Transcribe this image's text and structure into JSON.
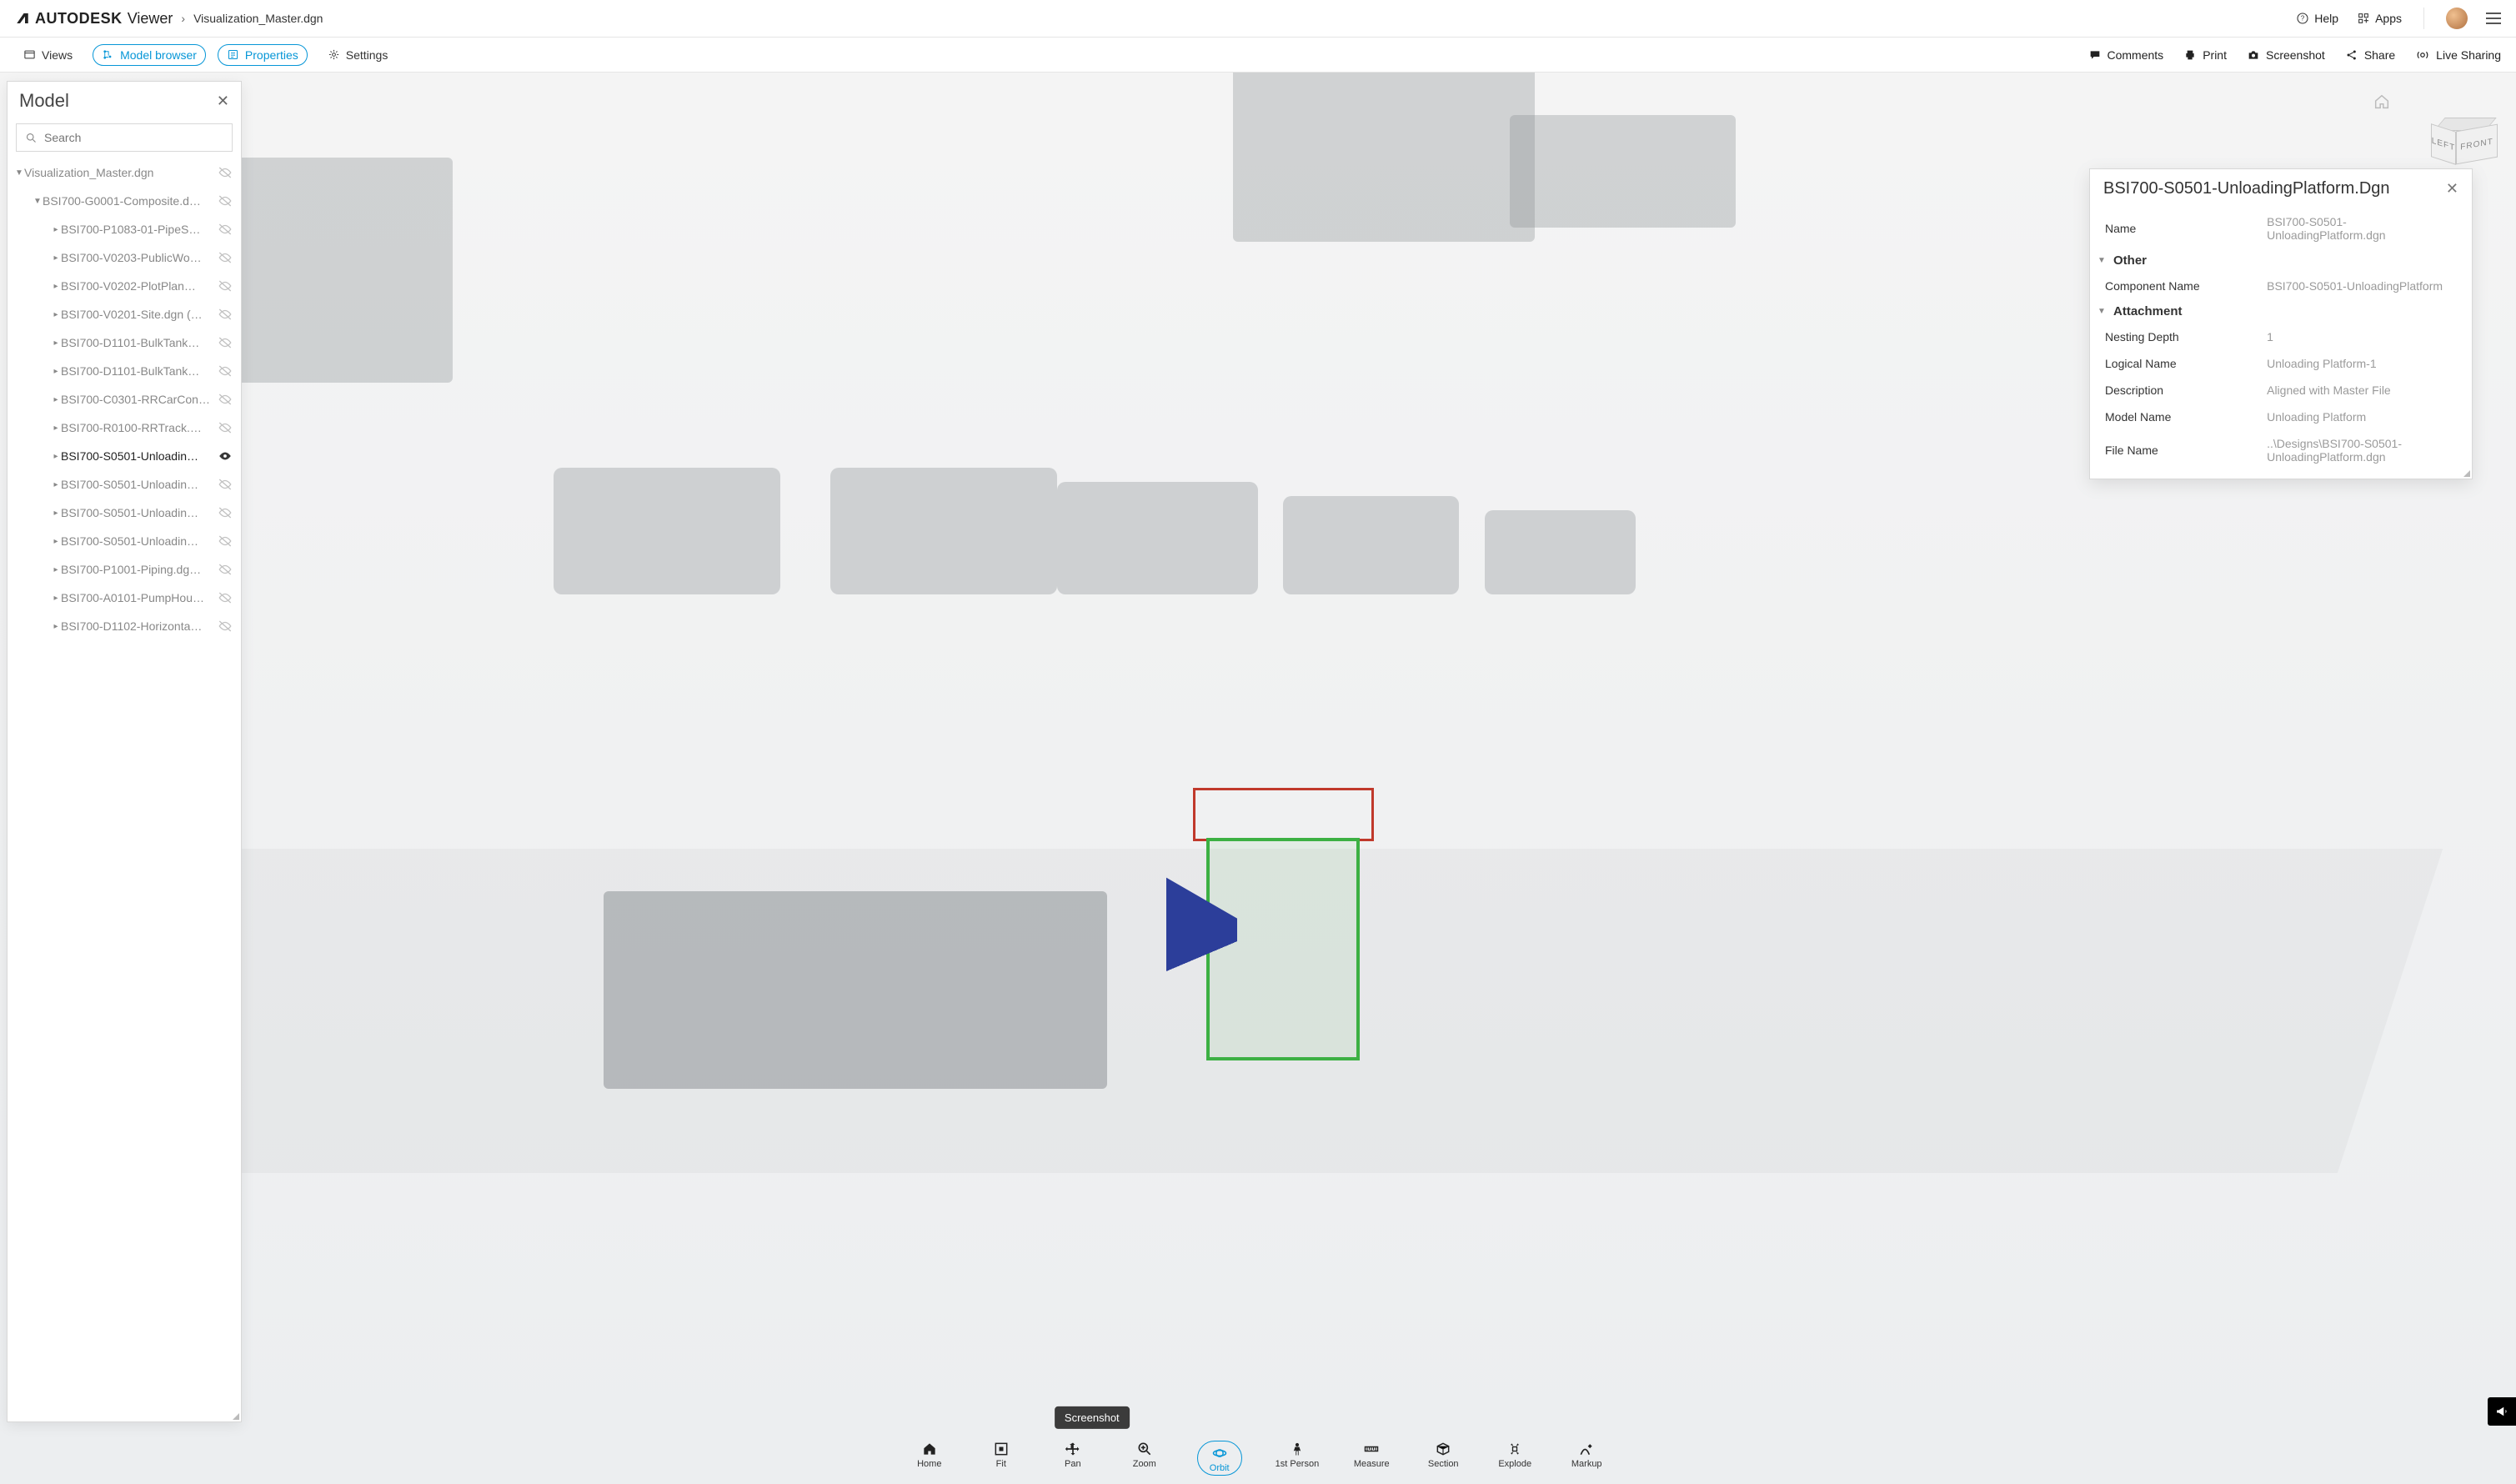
{
  "header": {
    "brand_bold": "AUTODESK",
    "brand_light": "Viewer",
    "breadcrumb_file": "Visualization_Master.dgn",
    "help": "Help",
    "apps": "Apps"
  },
  "subbar": {
    "views": "Views",
    "model_browser": "Model browser",
    "properties": "Properties",
    "settings": "Settings",
    "comments": "Comments",
    "print": "Print",
    "screenshot": "Screenshot",
    "share": "Share",
    "live_sharing": "Live Sharing"
  },
  "viewcube": {
    "front": "FRONT",
    "left": "LEFT"
  },
  "model_panel": {
    "title": "Model",
    "search_placeholder": "Search",
    "root": "Visualization_Master.dgn",
    "composite": "BSI700-G0001-Composite.d…",
    "items": [
      "BSI700-P1083-01-PipeS…",
      "BSI700-V0203-PublicWo…",
      "BSI700-V0202-PlotPlan…",
      "BSI700-V0201-Site.dgn (…",
      "BSI700-D1101-BulkTank…",
      "BSI700-D1101-BulkTank…",
      "BSI700-C0301-RRCarCon…",
      "BSI700-R0100-RRTrack.…",
      "BSI700-S0501-Unloadin…",
      "BSI700-S0501-Unloadin…",
      "BSI700-S0501-Unloadin…",
      "BSI700-S0501-Unloadin…",
      "BSI700-P1001-Piping.dg…",
      "BSI700-A0101-PumpHou…",
      "BSI700-D1102-Horizonta…"
    ],
    "active_index": 8
  },
  "props_panel": {
    "title": "BSI700-S0501-UnloadingPlatform.Dgn",
    "rows_top": [
      {
        "k": "Name",
        "v": "BSI700-S0501-UnloadingPlatform.dgn"
      }
    ],
    "group_other": "Other",
    "rows_other": [
      {
        "k": "Component Name",
        "v": "BSI700-S0501-UnloadingPlatform"
      }
    ],
    "group_attachment": "Attachment",
    "rows_attachment": [
      {
        "k": "Nesting Depth",
        "v": "1"
      },
      {
        "k": "Logical Name",
        "v": "Unloading Platform-1"
      },
      {
        "k": "Description",
        "v": "Aligned with Master File"
      },
      {
        "k": "Model Name",
        "v": "Unloading Platform"
      },
      {
        "k": "File Name",
        "v": "..\\Designs\\BSI700-S0501-UnloadingPlatform.dgn"
      }
    ]
  },
  "bottom": {
    "home": "Home",
    "fit": "Fit",
    "pan": "Pan",
    "zoom": "Zoom",
    "orbit": "Orbit",
    "first_person": "1st Person",
    "measure": "Measure",
    "section": "Section",
    "explode": "Explode",
    "markup": "Markup",
    "tooltip": "Screenshot"
  }
}
